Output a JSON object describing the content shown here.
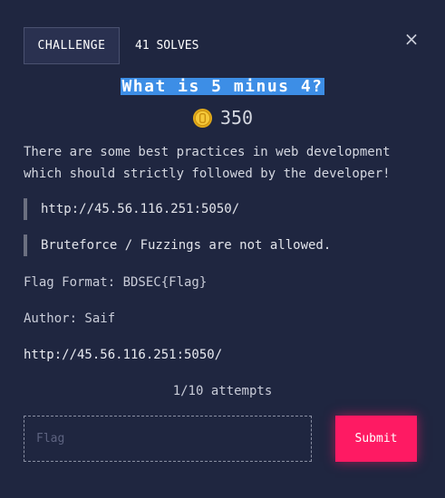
{
  "tabs": {
    "challenge_label": "CHALLENGE",
    "solves_label": "41 SOLVES"
  },
  "close_glyph": "×",
  "challenge": {
    "title": "What is 5 minus 4?",
    "points": "350",
    "description": "There are some best practices in web development which should strictly followed by the developer!",
    "quotes": [
      "http://45.56.116.251:5050/",
      "Bruteforce / Fuzzings are not allowed."
    ],
    "flag_format": "Flag Format: BDSEC{Flag}",
    "author": "Author: Saif",
    "link": "http://45.56.116.251:5050/"
  },
  "attempts": "1/10 attempts",
  "form": {
    "flag_placeholder": "Flag",
    "flag_value": "",
    "submit_label": "Submit"
  },
  "colors": {
    "background": "#1f2640",
    "title_highlight": "#3d8ee6",
    "submit": "#fe1a63",
    "coin": "#f2c12e"
  },
  "icons": {
    "close": "close-icon",
    "coin": "coin-icon"
  }
}
